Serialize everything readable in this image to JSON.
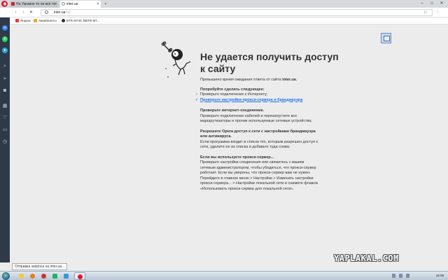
{
  "window": {
    "tabs": [
      {
        "title": "На Украине то ли всё то",
        "active": false
      },
      {
        "title": "inter.ua",
        "active": true
      }
    ],
    "controls": {
      "minimize": "–",
      "maximize": "□",
      "close": "✕"
    }
  },
  "addressbar": {
    "back": "‹",
    "forward": "›",
    "reload": "✕",
    "home": "⌂",
    "url": "inter.ua",
    "url_ghost": "/ru/",
    "go_icon": "▷",
    "heart_icon": "♡"
  },
  "bookmarks": [
    {
      "label": "Яндекс",
      "color": "#e53935"
    },
    {
      "label": "Авиабилеты",
      "color": "#f5a623"
    },
    {
      "label": "BTR M740, BBTR-M7…",
      "color": "#333333"
    }
  ],
  "sidebar": {
    "icons": [
      "messenger-icon",
      "whatsapp-icon",
      "telegram-icon",
      "search-icon",
      "send-icon",
      "camera-icon",
      "speed-dial-icon",
      "heart-icon",
      "history-icon",
      "clock-icon"
    ]
  },
  "error_page": {
    "title": "Не удается получить доступ к сайту",
    "lead_prefix": "Превышено время ожидания ответа от сайта",
    "lead_host": "inter.ua",
    "try_header": "Попробуйте сделать следующее:",
    "suggestions": [
      {
        "text": "Проверьте подключение к Интернету;",
        "link": false
      },
      {
        "text": "Проверьте настройки прокси-сервера и брандмауэра",
        "link": true
      }
    ],
    "sections": [
      {
        "header": "Проверьте интернет-соединение.",
        "body": "Проверьте подключение кабелей и перезапустите все маршрутизаторы и прочие используемые сетевые устройства."
      },
      {
        "header": "Разрешите Opera доступ к сети с настройками брандмауэра или антивируса.",
        "body": "Если программа входит в список тех, которым разрешен доступ к сети, удалите ее из списка и добавьте туда снова."
      },
      {
        "header": "Если вы используете прокси-сервер...",
        "body": "Проверьте настройки соединения или свяжитесь с вашим сетевым администратором, чтобы убедиться, что прокси-сервер работает. Если вы уверены, что прокси-сервер вам не нужен: Перейдите в главное меню > Настройки > Изменить настройки прокси-сервера... > Настройки локальной сети и снимите флажок «Использовать прокси-сервер для локальной сети»."
      }
    ]
  },
  "status_bubble": "Отправка запроса на inter.ua...",
  "watermark": "YAPLAKAL.COM",
  "taskbar": {
    "clock": "15:08"
  }
}
